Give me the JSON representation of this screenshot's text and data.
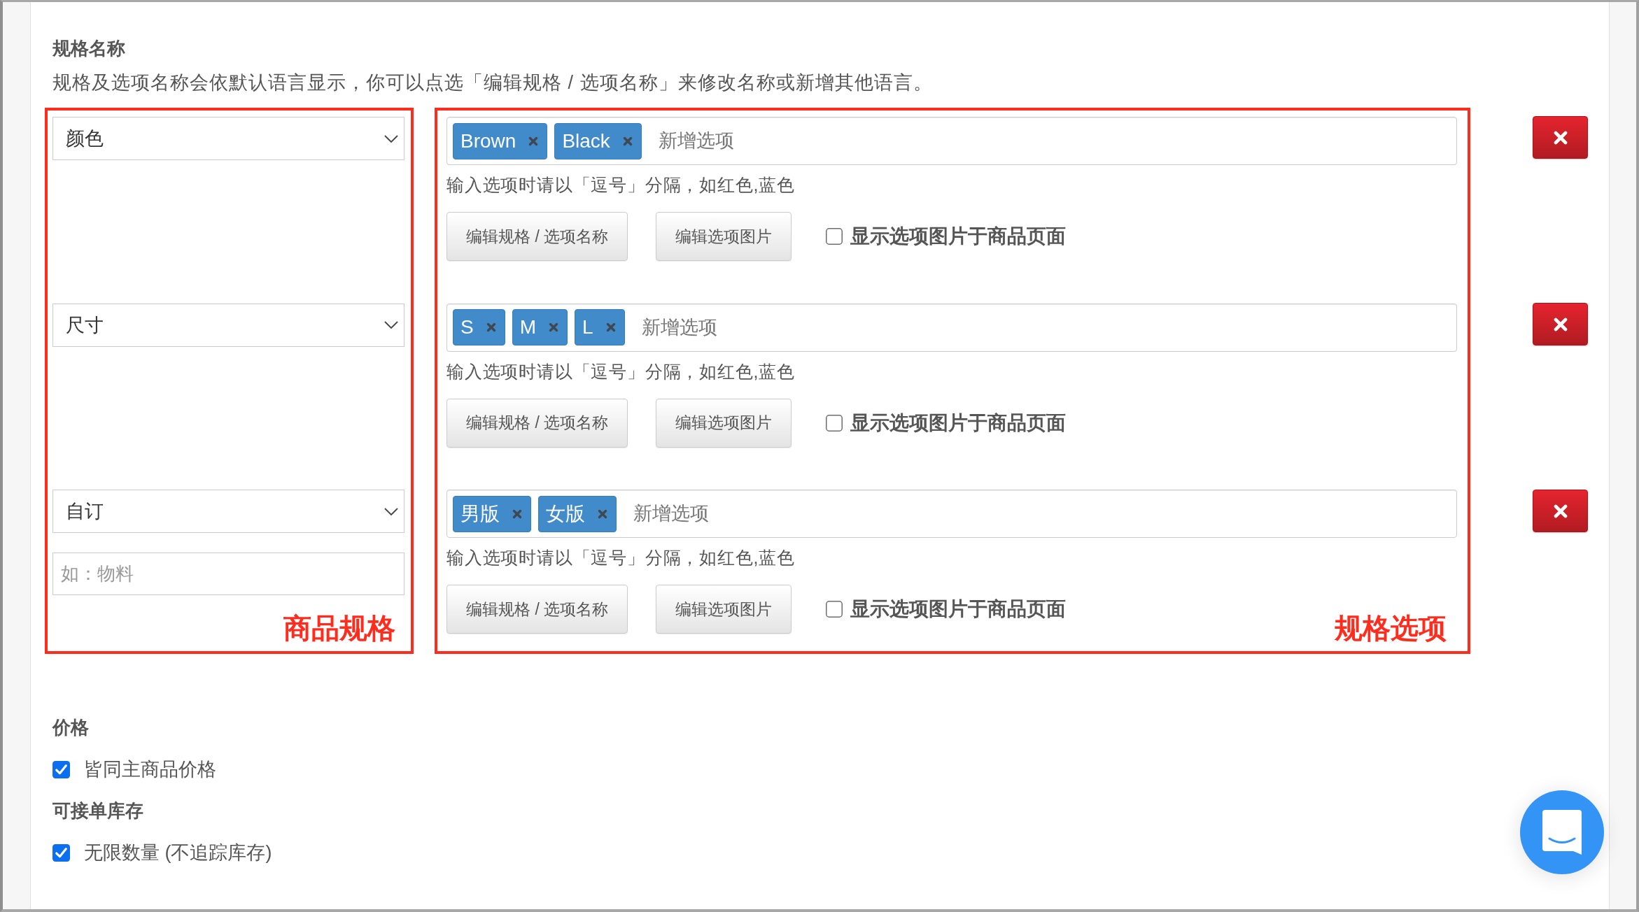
{
  "spec_section": {
    "title": "规格名称",
    "description": "规格及选项名称会依默认语言显示，你可以点选「编辑规格 / 选项名称」来修改名称或新增其他语言。",
    "name_column": {
      "annotation": "商品规格"
    },
    "option_column": {
      "annotation": "规格选项"
    },
    "specs": [
      {
        "name": "颜色",
        "options": [
          "Brown",
          "Black"
        ],
        "option_input": {
          "placeholder": "新增选项"
        },
        "hint": "输入选项时请以「逗号」分隔，如红色,蓝色",
        "buttons": [
          "编辑规格 / 选项名称",
          "编辑选项图片"
        ],
        "show_images": {
          "label": "显示选项图片于商品页面",
          "checked": false
        }
      },
      {
        "name": "尺寸",
        "options": [
          "S",
          "M",
          "L"
        ],
        "option_input": {
          "placeholder": "新增选项"
        },
        "hint": "输入选项时请以「逗号」分隔，如红色,蓝色",
        "buttons": [
          "编辑规格 / 选项名称",
          "编辑选项图片"
        ],
        "show_images": {
          "label": "显示选项图片于商品页面",
          "checked": false
        }
      },
      {
        "name": "自订",
        "custom_name": {
          "placeholder": "如：物料"
        },
        "options": [
          "男版",
          "女版"
        ],
        "option_input": {
          "placeholder": "新增选项"
        },
        "hint": "输入选项时请以「逗号」分隔，如红色,蓝色",
        "buttons": [
          "编辑规格 / 选项名称",
          "编辑选项图片"
        ],
        "show_images": {
          "label": "显示选项图片于商品页面",
          "checked": false
        }
      }
    ]
  },
  "price_section": {
    "title": "价格",
    "options": [
      {
        "label": "皆同主商品价格",
        "checked": true
      }
    ]
  },
  "stock_section": {
    "title": "可接单库存",
    "options": [
      {
        "label": "无限数量 (不追踪库存)",
        "checked": true
      }
    ]
  }
}
